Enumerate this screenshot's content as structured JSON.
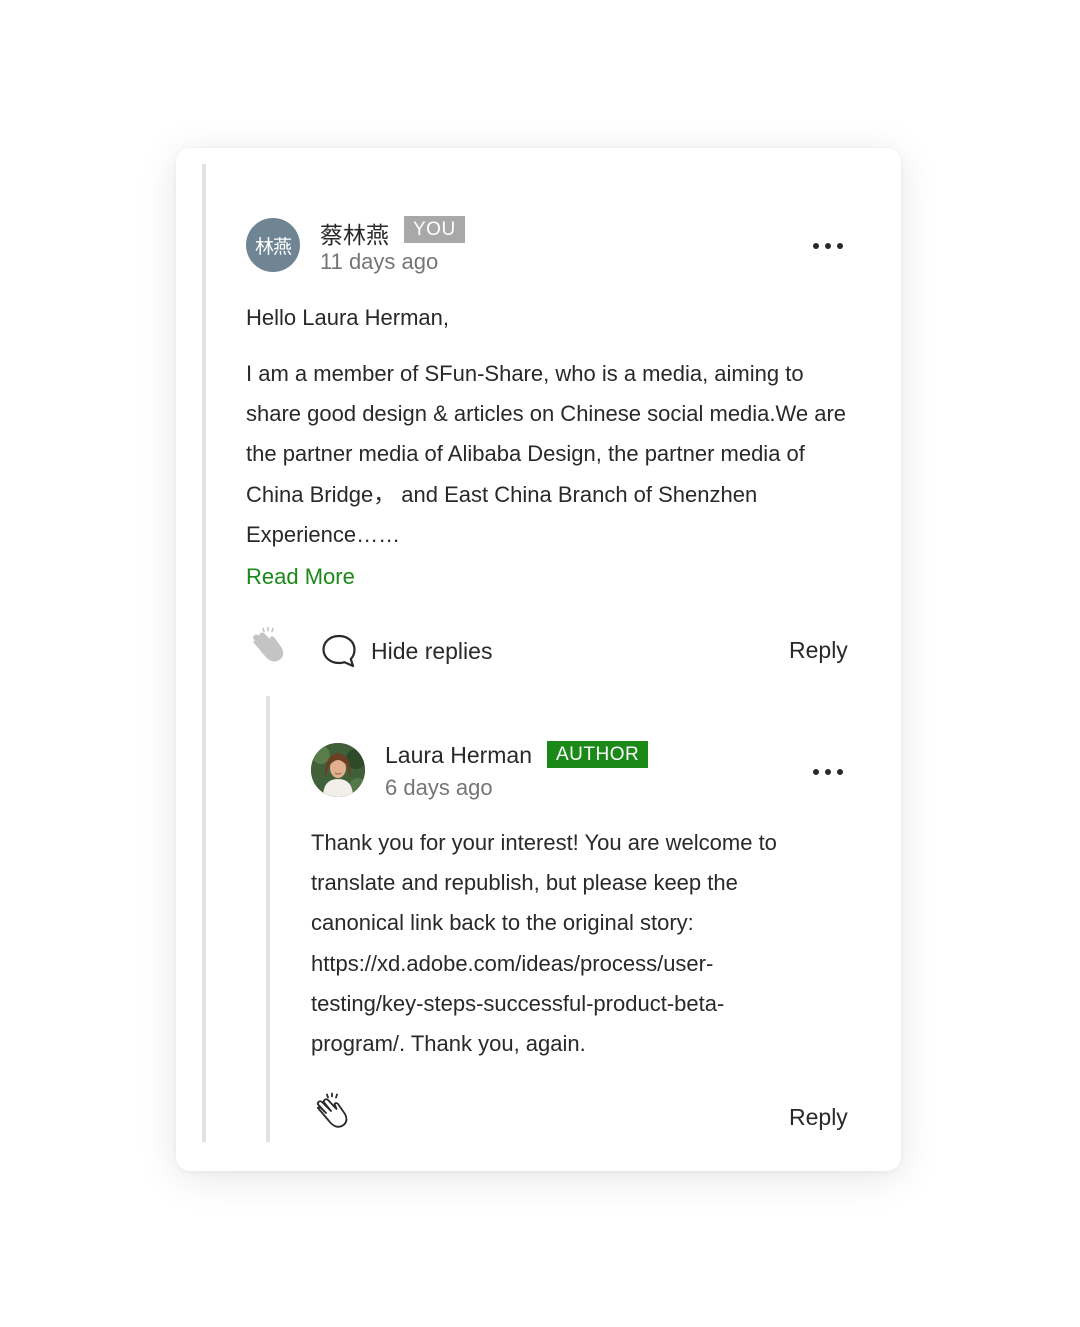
{
  "comment": {
    "avatar_initials": "林燕",
    "author": "蔡林燕",
    "badge": "YOU",
    "time": "11 days ago",
    "greeting": "Hello Laura Herman,",
    "body": "I am a member of SFun-Share, who is a media, aiming to share good design & articles on Chinese social media.We are the partner media of Alibaba Design, the partner media of China Bridge，  and East China Branch of Shenzhen Experience……",
    "read_more": "Read More",
    "hide_replies": "Hide replies",
    "reply": "Reply"
  },
  "reply_comment": {
    "author": "Laura Herman",
    "badge": "AUTHOR",
    "time": "6 days ago",
    "body": "Thank you for your interest! You are welcome to translate and republish, but please keep the canonical link back to the original story: https://xd.adobe.com/ideas/process/user-testing/key-steps-successful-product-beta-program/. Thank you, again.",
    "reply": "Reply"
  },
  "colors": {
    "accent_green": "#1a8917",
    "you_badge": "#a8a8a8",
    "avatar_bg": "#6f8594",
    "thread_line": "#e2e2e2"
  },
  "icons": [
    "clap-icon",
    "speech-bubble-icon",
    "more-options-icon"
  ]
}
